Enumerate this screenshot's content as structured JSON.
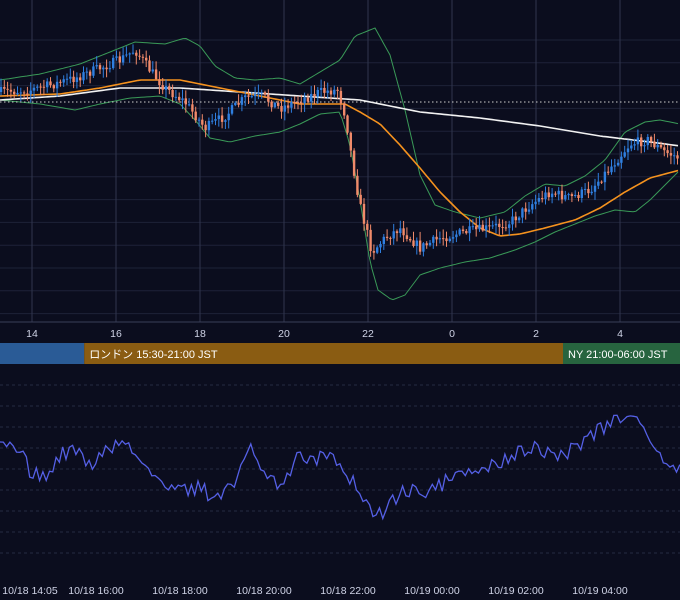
{
  "colors": {
    "background": "#0b0d1e",
    "grid": "#1e2238",
    "axis_text": "#cfd3e6",
    "candle_up": "#2f7fe0",
    "candle_down": "#f08a6a",
    "bollinger": "#3a9a58",
    "ma_fast": "#f5921e",
    "ma_slow": "#f2f2f2",
    "price_line": "#cfcfcf",
    "oscillator": "#5560e6",
    "session_tokyo": "#2a5b96",
    "session_london": "#8a5c12",
    "session_ny": "#27643f"
  },
  "sessions": [
    {
      "label": "",
      "color": "#2a5b96",
      "from": 0,
      "to": 1.3
    },
    {
      "label": "ロンドン 15:30-21:00 JST",
      "color": "#8a5c12",
      "from": 1.3,
      "to": 7.0
    },
    {
      "label": "NY 21:00-06:00 JST",
      "color": "#27643f",
      "from": 7.0,
      "to": 12.6
    }
  ],
  "chart_data": [
    {
      "type": "candlestick",
      "title": "",
      "x_ticks": [
        "14",
        "16",
        "18",
        "20",
        "22",
        "0",
        "2",
        "4"
      ],
      "overlays": [
        "bollinger-bands",
        "moving-average-fast",
        "moving-average-slow",
        "dotted-price-line"
      ],
      "grid": true,
      "y_tick_labels_visible": false
    },
    {
      "type": "line",
      "title": "",
      "x_ticks": [
        "10/18 14:05",
        "10/18 16:00",
        "10/18 18:00",
        "10/18 20:00",
        "10/18 22:00",
        "10/19 00:00",
        "10/19 02:00",
        "10/19 04:00"
      ],
      "grid": true,
      "y_tick_labels_visible": false
    }
  ]
}
